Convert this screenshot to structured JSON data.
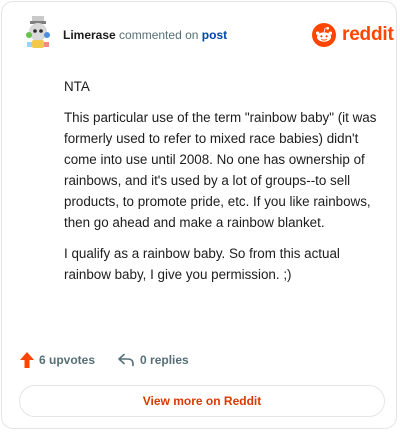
{
  "comment": {
    "author": "Limerase",
    "action_text": "commented on",
    "post_link": "post"
  },
  "brand": {
    "name": "reddit",
    "color": "#ff4500"
  },
  "body": {
    "paragraphs": [
      "NTA",
      "This particular use of the term \"rainbow baby\" (it was formerly used to refer to mixed race babies) didn't come into use until 2008. No one has ownership of rainbows, and it's used by a lot of groups--to sell products, to promote pride, etc. If you like rainbows, then go ahead and make a rainbow blanket.",
      "I qualify as a rainbow baby. So from this actual rainbow baby, I give you permission. ;)"
    ]
  },
  "actions": {
    "upvotes_label": "6 upvotes",
    "replies_label": "0 replies",
    "upvote_icon": "upvote-arrow-icon",
    "reply_icon": "reply-arrow-icon"
  },
  "footer": {
    "view_more_label": "View more on Reddit"
  }
}
